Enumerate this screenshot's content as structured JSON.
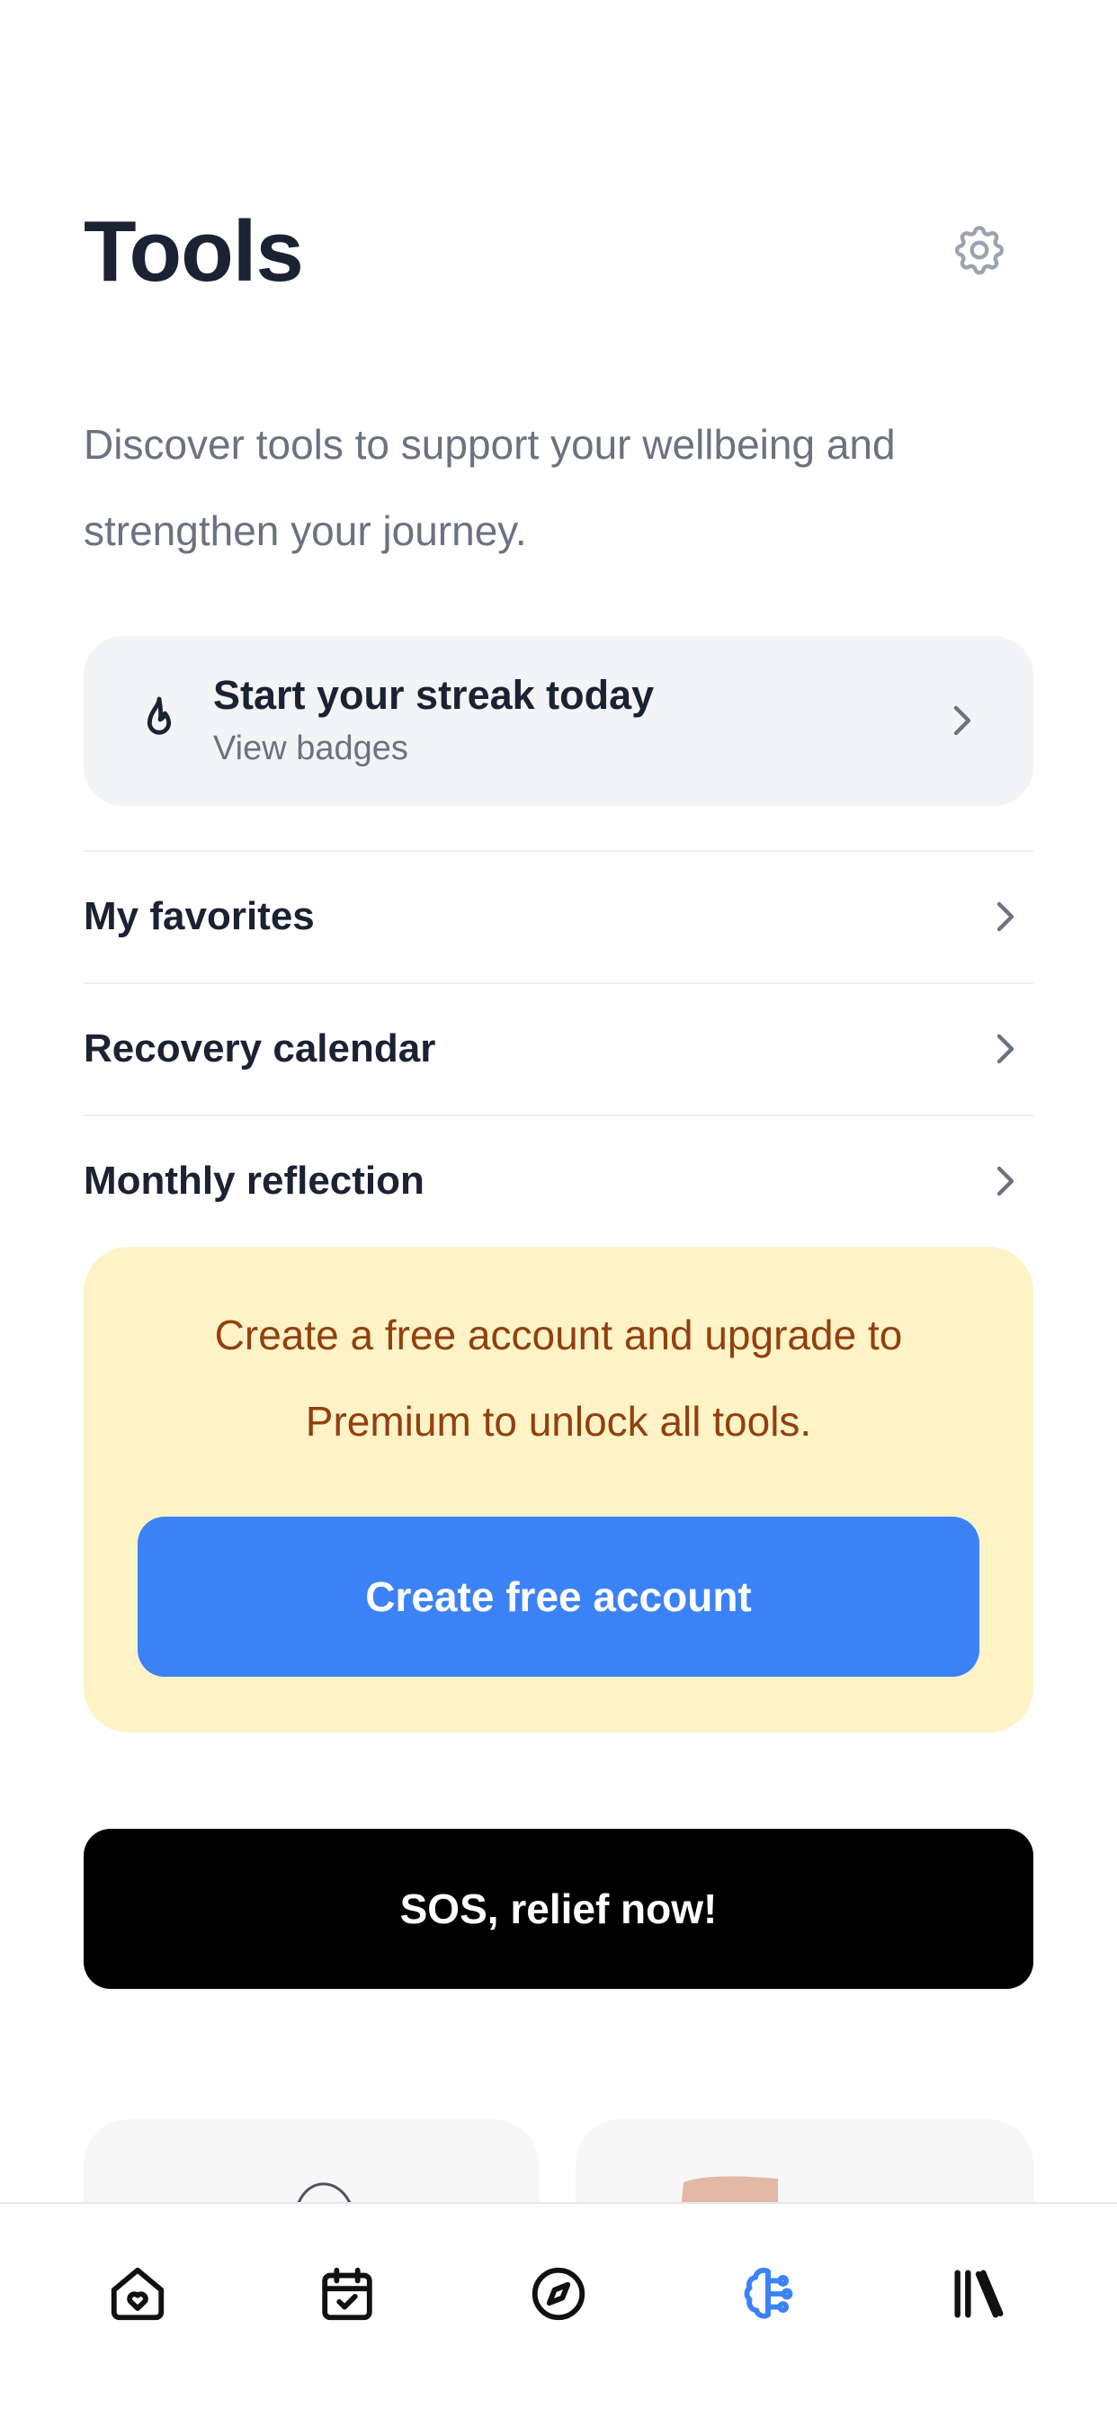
{
  "header": {
    "title": "Tools",
    "settings_icon": "gear-icon"
  },
  "subtitle": "Discover tools to support your wellbeing and strengthen your journey.",
  "streak": {
    "icon": "flame-icon",
    "title": "Start your streak today",
    "subtitle": "View badges"
  },
  "menu": {
    "items": [
      {
        "label": "My favorites"
      },
      {
        "label": "Recovery calendar"
      },
      {
        "label": "Monthly reflection"
      }
    ]
  },
  "promo": {
    "text": "Create a free account and upgrade to Premium to unlock all tools.",
    "button_label": "Create free account"
  },
  "sos": {
    "label": "SOS, relief now!"
  },
  "bottom_nav": {
    "items": [
      {
        "icon": "home-heart-icon",
        "active": false
      },
      {
        "icon": "calendar-check-icon",
        "active": false
      },
      {
        "icon": "compass-icon",
        "active": false
      },
      {
        "icon": "brain-tools-icon",
        "active": true
      },
      {
        "icon": "library-icon",
        "active": false
      }
    ]
  },
  "colors": {
    "text_primary": "#1a2233",
    "text_secondary": "#6b7280",
    "accent": "#3b82f6",
    "promo_bg": "#fef3c7",
    "promo_text": "#92400e",
    "sos_bg": "#000000",
    "card_bg": "#f3f4f6"
  }
}
